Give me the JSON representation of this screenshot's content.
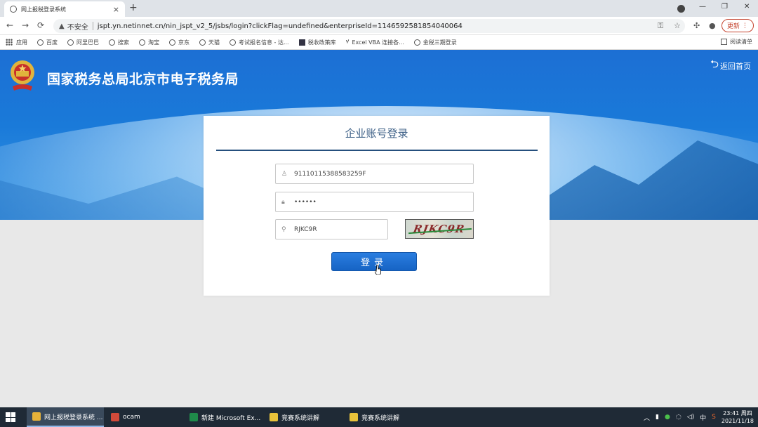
{
  "browser": {
    "tab_title": "网上报税登录系统",
    "tab_close": "×",
    "new_tab": "+",
    "insecure_label": "不安全",
    "url": "jspt.yn.netinnet.cn/nin_jspt_v2_5/jsbs/login?clickFlag=undefined&enterpriseId=114659258185404006​4",
    "update_label": "更新",
    "min": "—",
    "max": "❐",
    "close": "✕",
    "back": "←",
    "forward": "→",
    "reload": "⟳"
  },
  "bookmarks": {
    "items": [
      {
        "label": "应用",
        "icon": "apps-grid-icon"
      },
      {
        "label": "百度",
        "icon": "globe-icon"
      },
      {
        "label": "阿里巴巴",
        "icon": "globe-icon"
      },
      {
        "label": "搜索",
        "icon": "globe-icon"
      },
      {
        "label": "淘宝",
        "icon": "globe-icon"
      },
      {
        "label": "京东",
        "icon": "globe-icon"
      },
      {
        "label": "天猫",
        "icon": "globe-icon"
      },
      {
        "label": "考试报名信息 - 达...",
        "icon": "globe-icon"
      },
      {
        "label": "税收政策库",
        "icon": "doc-icon"
      },
      {
        "label": "Excel VBA 连接各...",
        "icon": "vba-icon"
      },
      {
        "label": "金税三期登录",
        "icon": "globe-icon"
      }
    ],
    "reading_list": "阅读清单"
  },
  "page": {
    "site_title": "国家税务总局北京市电子税务局",
    "back_home": "返回首页",
    "login": {
      "title": "企业账号登录",
      "username_value": "91110115388583259F",
      "password_value": "••••••",
      "captcha_value": "RJKC9R",
      "captcha_image_text": "RJKC9R",
      "submit_label": "登录"
    }
  },
  "taskbar": {
    "tasks": [
      {
        "label": "网上报税登录系统 ...",
        "icon_color": "#e8b33a"
      },
      {
        "label": "ocam",
        "icon_color": "#d24a3a"
      },
      {
        "label": "新建 Microsoft Ex...",
        "icon_color": "#1f8a4a"
      },
      {
        "label": "竞赛系统讲解",
        "icon_color": "#e8c23a"
      },
      {
        "label": "竞赛系统讲解",
        "icon_color": "#e8c23a"
      }
    ],
    "ime": "中",
    "time": "23:41 周四",
    "date": "2021/11/18"
  },
  "colors": {
    "banner_blue": "#1c6fd4",
    "title_rule": "#254f7d",
    "button_blue": "#1663c4",
    "update_red": "#c5432f"
  }
}
